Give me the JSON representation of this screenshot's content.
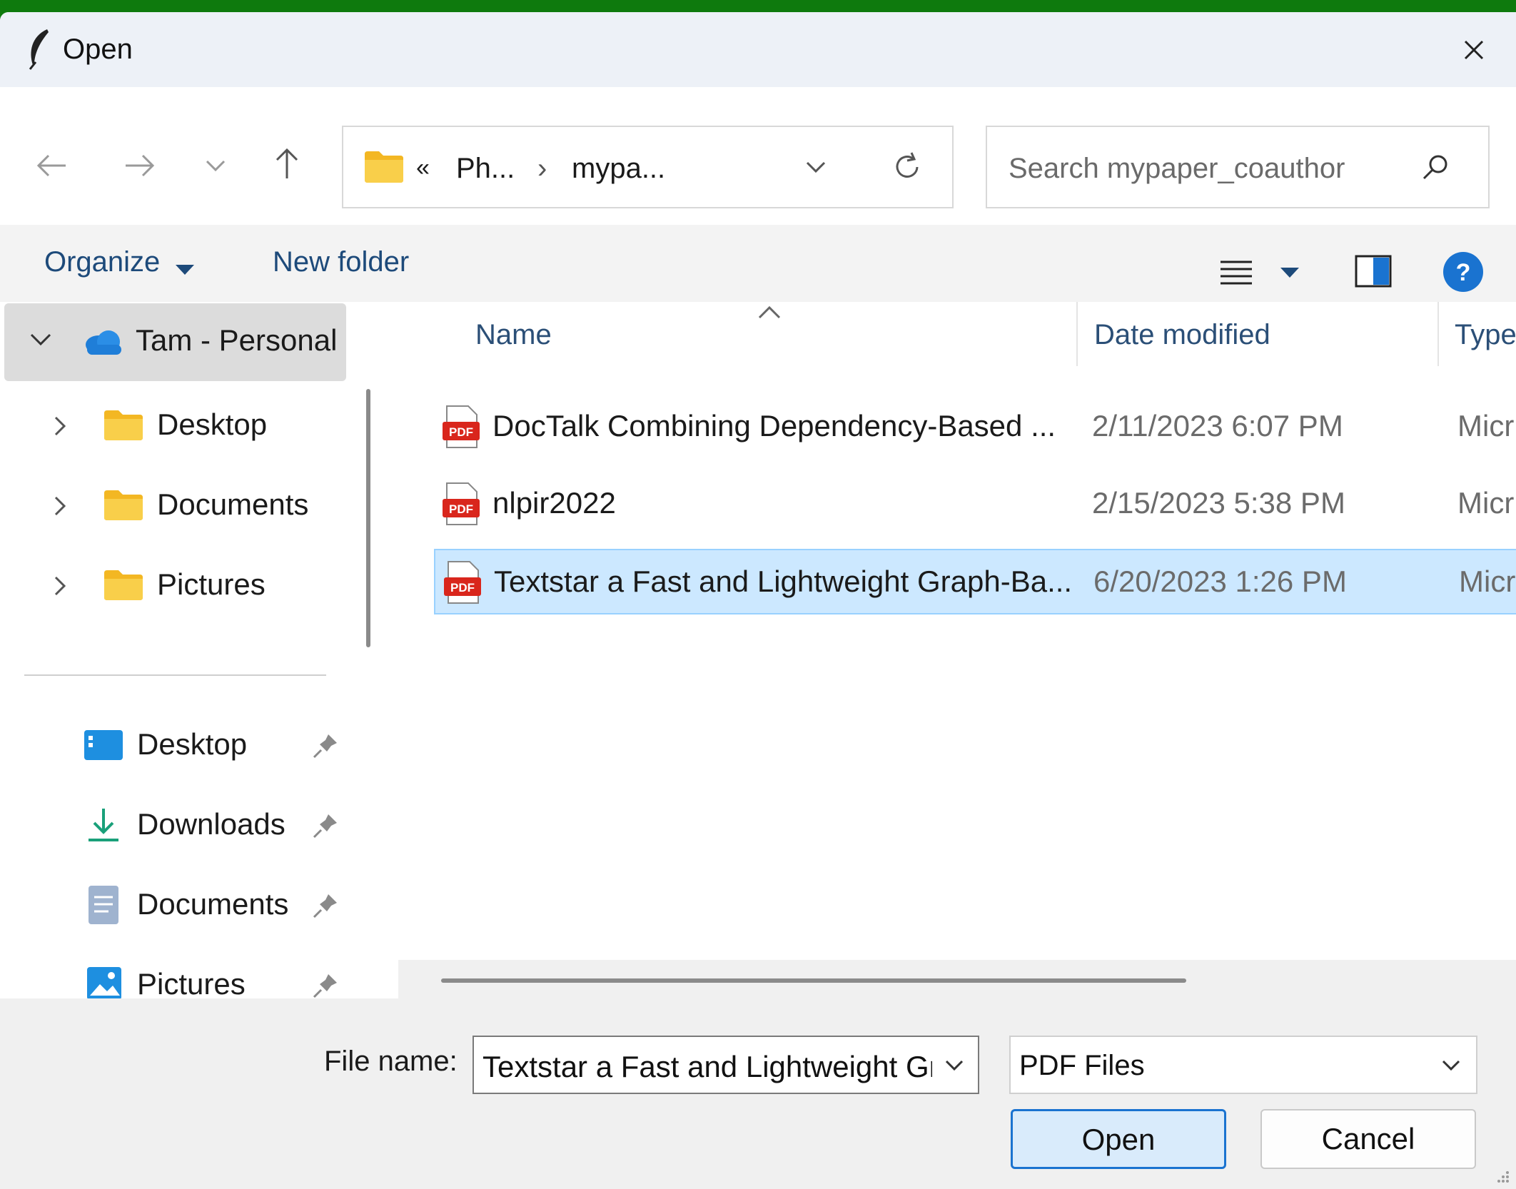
{
  "window": {
    "title": "Open"
  },
  "navigation": {
    "address": {
      "prefix": "«",
      "crumb1": "Ph...",
      "separator": "›",
      "crumb2": "mypa..."
    },
    "search_placeholder": "Search mypaper_coauthor"
  },
  "commandbar": {
    "organize": "Organize",
    "new_folder": "New folder"
  },
  "sidebar": {
    "root": "Tam - Personal",
    "tree_items": [
      "Desktop",
      "Documents",
      "Pictures"
    ],
    "quick_access": [
      "Desktop",
      "Downloads",
      "Documents",
      "Pictures"
    ]
  },
  "filelist": {
    "columns": {
      "name": "Name",
      "date_modified": "Date modified",
      "type": "Type"
    },
    "files": [
      {
        "name": "DocTalk Combining Dependency-Based ...",
        "date": "2/11/2023 6:07 PM",
        "type": "Micr"
      },
      {
        "name": "nlpir2022",
        "date": "2/15/2023 5:38 PM",
        "type": "Micr"
      },
      {
        "name": "Textstar a Fast and Lightweight Graph-Ba...",
        "date": "6/20/2023 1:26 PM",
        "type": "Micr"
      }
    ],
    "selected_index": 2
  },
  "footer": {
    "file_name_label": "File name:",
    "file_name_value": "Textstar a Fast and Lightweight Gra",
    "file_type_value": "PDF Files",
    "open_button": "Open",
    "cancel_button": "Cancel"
  },
  "colors": {
    "accent": "#1a73d0",
    "selection": "#cce8ff",
    "pdf_red": "#d9261c",
    "folder_yellow": "#f7c948"
  }
}
